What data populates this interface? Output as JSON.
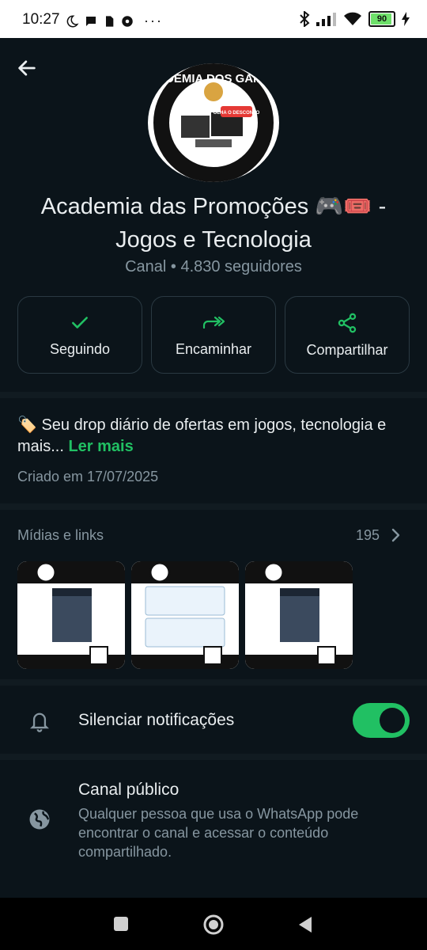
{
  "status_bar": {
    "time": "10:27",
    "battery": "90"
  },
  "channel": {
    "name": "Academia das Promoções 🎮🎟️ - Jogos e Tecnologia",
    "meta": "Canal • 4.830 seguidores",
    "avatar_text": [
      "ACADEMIA DOS GAMERS",
      "OLHA O DESCONTO"
    ]
  },
  "actions": [
    {
      "label": "Seguindo",
      "icon": "check-icon"
    },
    {
      "label": "Encaminhar",
      "icon": "forward-icon"
    },
    {
      "label": "Compartilhar",
      "icon": "share-icon"
    }
  ],
  "description": {
    "text": "🏷️ Seu drop diário de ofertas em jogos, tecnologia e mais...",
    "more": "Ler mais",
    "created": "Criado em 17/07/2025"
  },
  "media": {
    "title": "Mídias e links",
    "count": "195"
  },
  "mute": {
    "label": "Silenciar notificações",
    "enabled": true
  },
  "public": {
    "label": "Canal público",
    "description": "Qualquer pessoa que usa o WhatsApp pode encontrar o canal e acessar o conteúdo compartilhado."
  },
  "colors": {
    "accent": "#21c063",
    "background": "#0b141a",
    "muted_text": "#8696a0"
  }
}
